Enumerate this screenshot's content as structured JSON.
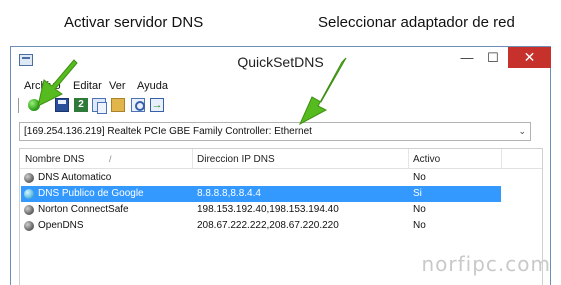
{
  "annotations": {
    "left": "Activar servidor DNS",
    "right": "Seleccionar adaptador de red"
  },
  "window": {
    "title": "QuickSetDNS",
    "buttons": {
      "minimize": "—",
      "maximize": "☐",
      "close": "✕"
    }
  },
  "menu": {
    "archivo": "Archivo",
    "editar": "Editar",
    "ver": "Ver",
    "ayuda": "Ayuda"
  },
  "toolbar": {
    "icons": [
      "activate-dns-icon",
      "save-icon",
      "refresh-icon",
      "copy-icon",
      "open-folder-icon",
      "search-icon",
      "exit-icon"
    ]
  },
  "adapter_select": {
    "value": "[169.254.136.219]  Realtek PCIe GBE Family Controller: Ethernet"
  },
  "table": {
    "columns": [
      "Nombre DNS",
      "Direccion IP DNS",
      "Activo"
    ],
    "rows": [
      {
        "name": "DNS Automatico",
        "ip": "",
        "active": "No"
      },
      {
        "name": "DNS Publico de Google",
        "ip": "8.8.8.8,8.8.4.4",
        "active": "Si"
      },
      {
        "name": "Norton ConnectSafe",
        "ip": "198.153.192.40,198.153.194.40",
        "active": "No"
      },
      {
        "name": "OpenDNS",
        "ip": "208.67.222.222,208.67.220.220",
        "active": "No"
      }
    ],
    "selected_row": 1
  },
  "colors": {
    "selection": "#3399ff",
    "close_button": "#c7312b",
    "annotation_arrow": "#55bb1e"
  },
  "watermark": "norfipc.com"
}
